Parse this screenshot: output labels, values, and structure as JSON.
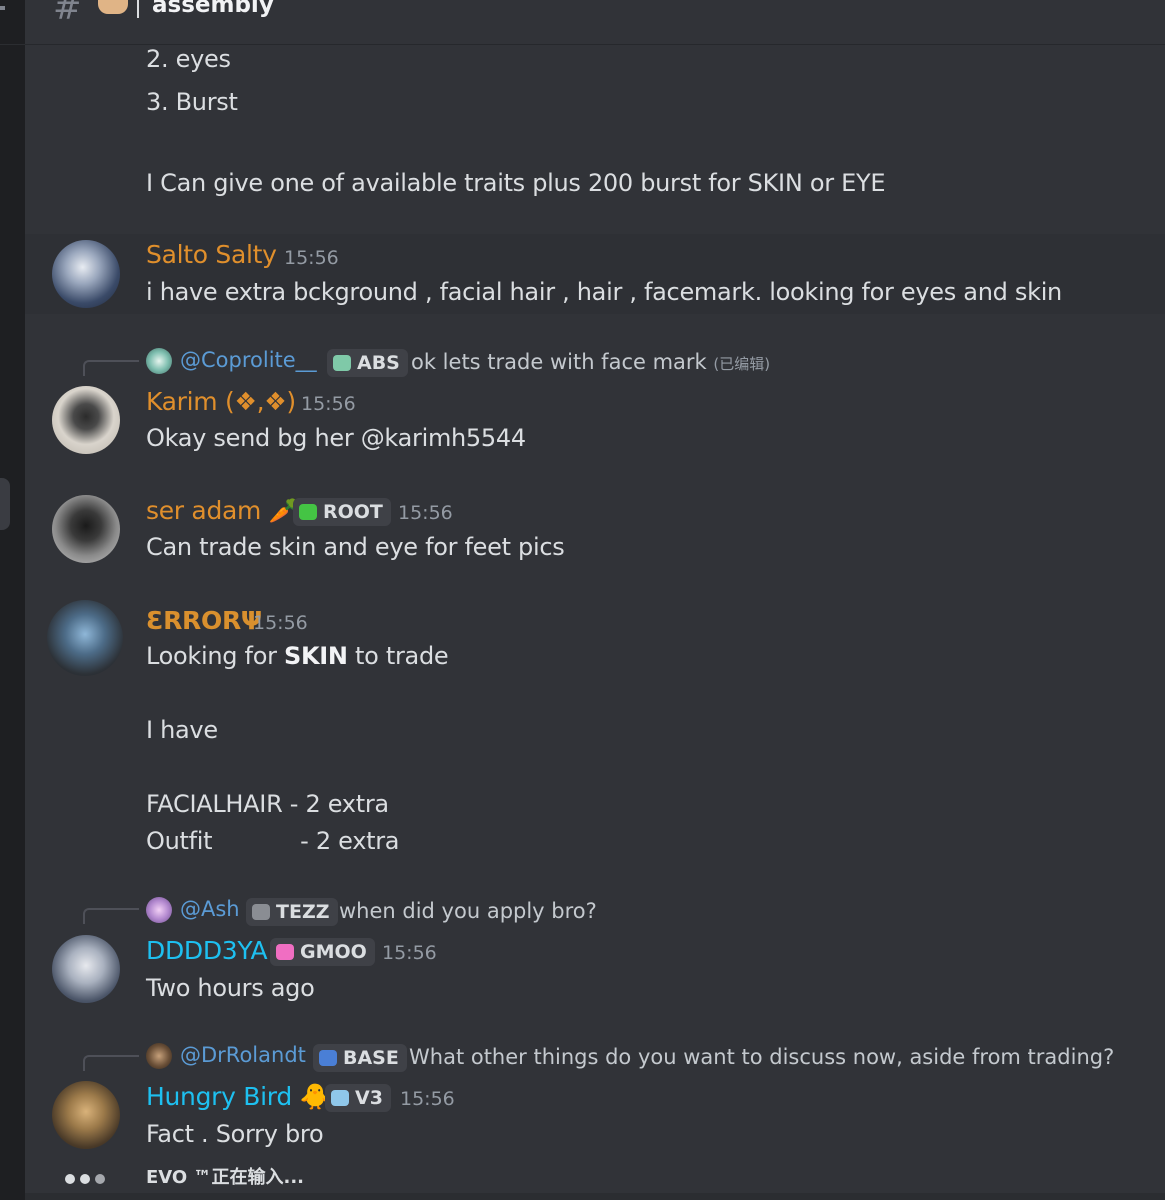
{
  "channel": {
    "hash_icon": "#",
    "emoji_icon": "handshake-emoji",
    "name": "assembly"
  },
  "previous_message": {
    "lines": [
      "2. eyes",
      "3. Burst",
      "I Can give one of available traits plus 200 burst for SKIN or EYE"
    ]
  },
  "messages": [
    {
      "id": "salto",
      "author": "Salto Salty",
      "author_color": "#e08f2c",
      "timestamp": "15:56",
      "text": "i have extra bckground , facial hair , hair , facemark. looking for eyes and skin"
    },
    {
      "id": "karim",
      "reply": {
        "name": "@Coprolite__",
        "tag": "ABS",
        "text": "ok lets trade with face mark",
        "edited": "(已编辑)"
      },
      "author": "Karim (❖,❖)",
      "author_color": "#e08f2c",
      "timestamp": "15:56",
      "text": "Okay send bg her @karimh5544"
    },
    {
      "id": "adam",
      "author": "ser adam 🥕",
      "author_color": "#e08f2c",
      "tag": "ROOT",
      "timestamp": "15:56",
      "text": "Can trade skin and eye for feet pics"
    },
    {
      "id": "error",
      "author": "ƐRRORΨ",
      "author_color": "#e08f2c",
      "timestamp": "15:56",
      "text_prefix": "Looking for ",
      "text_bold": "SKIN",
      "text_suffix": " to trade",
      "extra_lines": [
        "I have",
        "FACIALHAIR - 2 extra",
        "Outfit            - 2 extra"
      ]
    },
    {
      "id": "dddd",
      "reply": {
        "name": "@Ash",
        "tag": "TEZZ",
        "text": "when did you apply bro?"
      },
      "author": "DDDD3YA",
      "author_color": "#1ec0f0",
      "tag": "GMOO",
      "timestamp": "15:56",
      "text": "Two hours ago"
    },
    {
      "id": "hungry",
      "reply": {
        "name": "@DrRolandt",
        "tag": "BASE",
        "text": "What other things do you want to discuss now, aside from trading?"
      },
      "author": "Hungry Bird 🐥",
      "author_color": "#1ec0f0",
      "tag": "V3",
      "timestamp": "15:56",
      "text": "Fact . Sorry bro"
    }
  ],
  "typing_indicator": "EVO ™正在输入..."
}
